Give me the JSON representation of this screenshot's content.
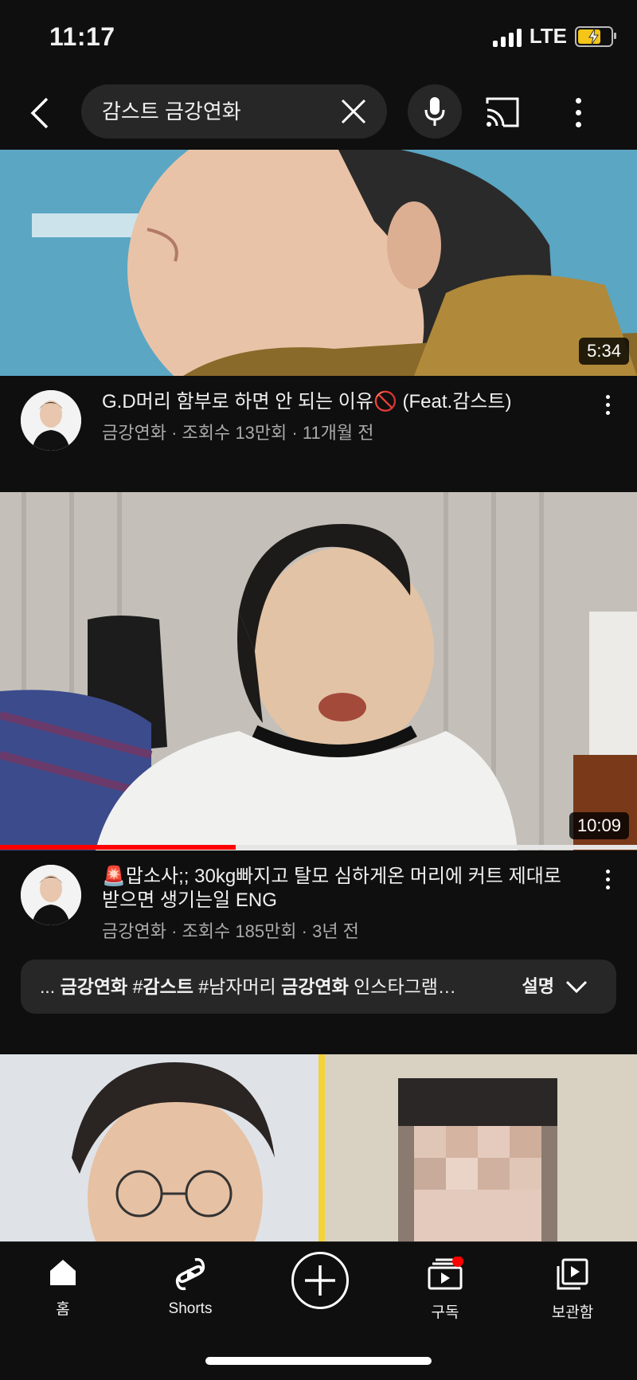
{
  "status": {
    "time": "11:17",
    "network": "LTE"
  },
  "header": {
    "search_query": "감스트 금강연화"
  },
  "videos": [
    {
      "title": "G.D머리 함부로 하면 안 되는 이유🚫 (Feat.감스트)",
      "meta": "금강연화 · 조회수 13만회 · 11개월 전",
      "duration": "5:34"
    },
    {
      "title": "🚨맙소사;; 30kg빠지고 탈모 심하게온 머리에 커트 제대로 받으면 생기는일 ENG",
      "meta": "금강연화 · 조회수 185만회 · 3년 전",
      "duration": "10:09",
      "watched_fraction": 0.37,
      "description": {
        "prefix": "... ",
        "part1": "금강연화",
        "part2": " #",
        "part3": "감스트",
        "part4": " #남자머리 ",
        "part5": "금강연화",
        "part6": " 인스타그램…",
        "button": "설명"
      }
    }
  ],
  "bottom_nav": [
    {
      "label": "홈",
      "icon": "home-icon"
    },
    {
      "label": "Shorts",
      "icon": "shorts-icon"
    },
    {
      "label": "",
      "icon": "create-icon"
    },
    {
      "label": "구독",
      "icon": "subscriptions-icon"
    },
    {
      "label": "보관함",
      "icon": "library-icon"
    }
  ],
  "colors": {
    "background": "#0f0f0f",
    "accent": "#ff0000",
    "surface": "#272727"
  }
}
